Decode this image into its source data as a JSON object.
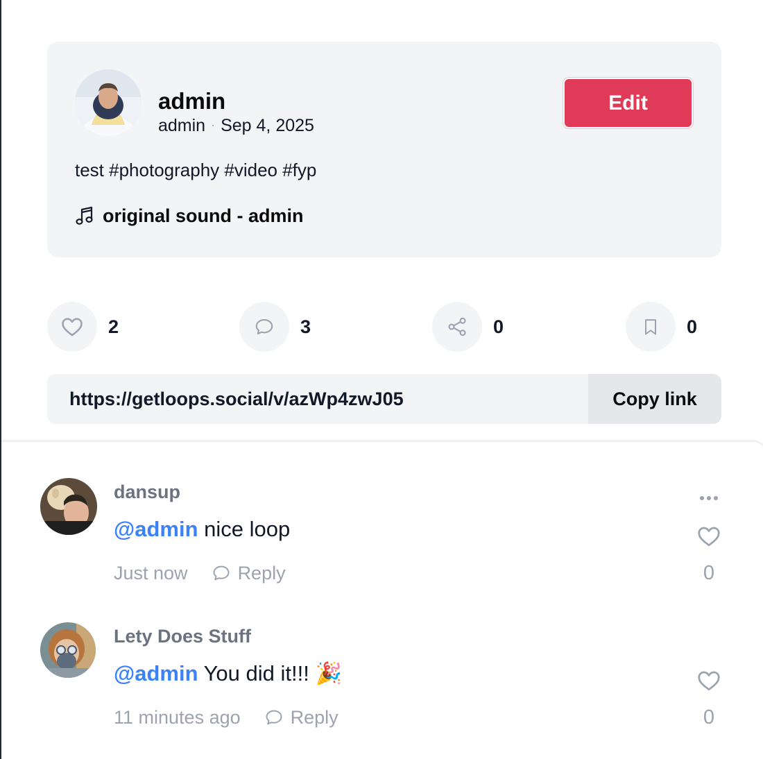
{
  "post": {
    "author_name": "admin",
    "author_handle": "admin",
    "date": "Sep 4, 2025",
    "edit_label": "Edit",
    "caption": "test #photography #video #fyp",
    "sound": "original sound - admin"
  },
  "actions": {
    "likes": "2",
    "comments": "3",
    "shares": "0",
    "bookmarks": "0"
  },
  "share": {
    "url": "https://getloops.social/v/azWp4zwJ05",
    "copy_label": "Copy link"
  },
  "comments": [
    {
      "user": "dansup",
      "mention": "@admin",
      "text": " nice loop",
      "time": "Just now",
      "reply_label": "Reply",
      "likes": "0"
    },
    {
      "user": "Lety Does Stuff",
      "mention": "@admin",
      "text": " You did it!!! 🎉",
      "time": "11 minutes ago",
      "reply_label": "Reply",
      "likes": "0"
    }
  ],
  "icons": {
    "music": "music-note-icon",
    "like": "heart-icon",
    "comment": "chat-bubble-icon",
    "share": "share-icon",
    "bookmark": "bookmark-icon",
    "more": "more-dots-icon"
  },
  "colors": {
    "accent": "#e03a59",
    "mention": "#3b82f6",
    "card_bg": "#f3f4f6"
  }
}
